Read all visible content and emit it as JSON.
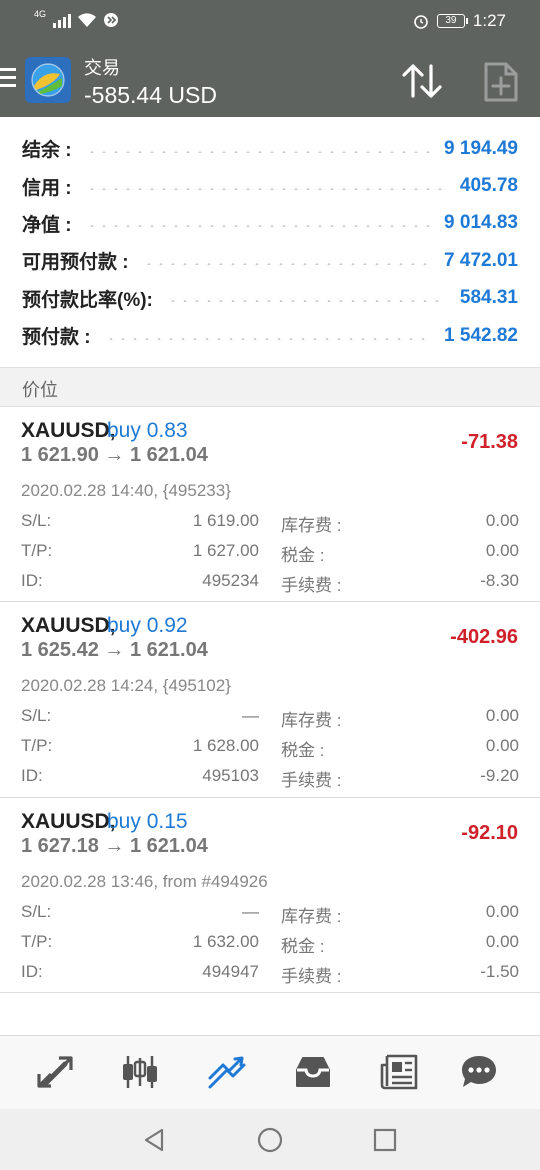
{
  "status_bar": {
    "network": "4G",
    "battery": "39",
    "time": "1:27"
  },
  "header": {
    "title": "交易",
    "balance": "-585.44 USD",
    "icons": [
      "menu-icon",
      "metatrader-logo",
      "sort-icon",
      "new-order-icon"
    ]
  },
  "account": [
    {
      "label": "结余 :",
      "value": "9 194.49"
    },
    {
      "label": "信用 :",
      "value": "405.78"
    },
    {
      "label": "净值 :",
      "value": "9 014.83"
    },
    {
      "label": "可用预付款 :",
      "value": "7 472.01"
    },
    {
      "label": "预付款比率(%):",
      "value": "584.31"
    },
    {
      "label": "预付款 :",
      "value": "1 542.82"
    }
  ],
  "section_title": "价位",
  "positions": [
    {
      "symbol": "XAUUSD,",
      "side": "buy 0.83",
      "prices": "1 621.90 → 1 621.04",
      "profit": "-71.38",
      "time": "2020.02.28 14:40, {495233}",
      "sl_label": "S/L:",
      "sl": "1 619.00",
      "tp_label": "T/P:",
      "tp": "1 627.00",
      "id_label": "ID:",
      "id": "495234",
      "swap_label": "库存费 :",
      "swap": "0.00",
      "tax_label": "税金 :",
      "tax": "0.00",
      "fee_label": "手续费 :",
      "fee": "-8.30"
    },
    {
      "symbol": "XAUUSD,",
      "side": "buy 0.92",
      "prices": "1 625.42 → 1 621.04",
      "profit": "-402.96",
      "time": "2020.02.28 14:24, {495102}",
      "sl_label": "S/L:",
      "sl": "—",
      "tp_label": "T/P:",
      "tp": "1 628.00",
      "id_label": "ID:",
      "id": "495103",
      "swap_label": "库存费 :",
      "swap": "0.00",
      "tax_label": "税金 :",
      "tax": "0.00",
      "fee_label": "手续费 :",
      "fee": "-9.20"
    },
    {
      "symbol": "XAUUSD,",
      "side": "buy 0.15",
      "prices": "1 627.18 → 1 621.04",
      "profit": "-92.10",
      "time": "2020.02.28 13:46, from #494926",
      "sl_label": "S/L:",
      "sl": "—",
      "tp_label": "T/P:",
      "tp": "1 632.00",
      "id_label": "ID:",
      "id": "494947",
      "swap_label": "库存费 :",
      "swap": "0.00",
      "tax_label": "税金 :",
      "tax": "0.00",
      "fee_label": "手续费 :",
      "fee": "-1.50"
    }
  ],
  "bottom_nav": [
    "quotes-icon",
    "chart-icon",
    "trade-icon",
    "history-icon",
    "news-icon",
    "chat-icon"
  ],
  "colors": {
    "header_bg": "#5f6360",
    "accent_blue": "#1e7ad6",
    "loss_red": "#d0202a"
  }
}
